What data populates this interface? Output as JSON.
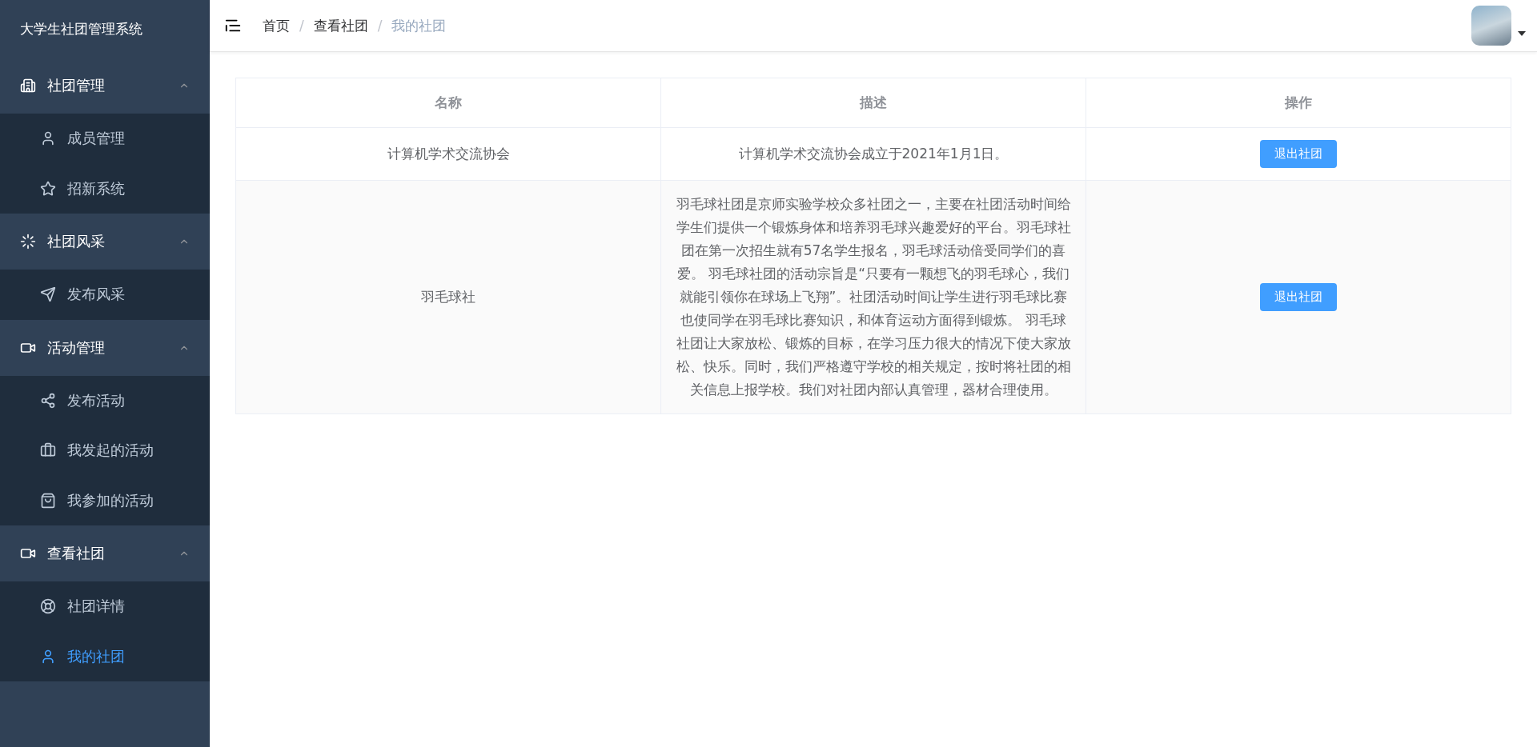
{
  "sidebar": {
    "title": "大学生社团管理系统",
    "groups": [
      {
        "label": "社团管理",
        "expanded": true,
        "items": [
          {
            "label": "成员管理",
            "selected": false
          },
          {
            "label": "招新系统",
            "selected": false
          }
        ]
      },
      {
        "label": "社团风采",
        "expanded": true,
        "items": [
          {
            "label": "发布风采",
            "selected": false
          }
        ]
      },
      {
        "label": "活动管理",
        "expanded": true,
        "items": [
          {
            "label": "发布活动",
            "selected": false
          },
          {
            "label": "我发起的活动",
            "selected": false
          },
          {
            "label": "我参加的活动",
            "selected": false
          }
        ]
      },
      {
        "label": "查看社团",
        "expanded": true,
        "items": [
          {
            "label": "社团详情",
            "selected": false
          },
          {
            "label": "我的社团",
            "selected": true
          }
        ]
      }
    ]
  },
  "header": {
    "breadcrumbs": [
      {
        "label": "首页",
        "selected": false
      },
      {
        "label": "查看社团",
        "selected": false
      },
      {
        "label": "我的社团",
        "selected": true
      }
    ],
    "separator": "/"
  },
  "table": {
    "columns": [
      "名称",
      "描述",
      "操作"
    ],
    "rows": [
      {
        "name": "计算机学术交流协会",
        "description": "计算机学术交流协会成立于2021年1月1日。",
        "action": "退出社团"
      },
      {
        "name": "羽毛球社",
        "description": "羽毛球社团是京师实验学校众多社团之一，主要在社团活动时间给学生们提供一个锻炼身体和培养羽毛球兴趣爱好的平台。羽毛球社团在第一次招生就有57名学生报名，羽毛球活动倍受同学们的喜爱。 羽毛球社团的活动宗旨是“只要有一颗想飞的羽毛球心，我们就能引领你在球场上飞翔”。社团活动时间让学生进行羽毛球比赛也使同学在羽毛球比赛知识，和体育运动方面得到锻炼。 羽毛球社团让大家放松、锻炼的目标，在学习压力很大的情况下使大家放松、快乐。同时，我们严格遵守学校的相关规定，按时将社团的相关信息上报学校。我们对社团内部认真管理，器材合理使用。",
        "action": "退出社团"
      }
    ]
  }
}
